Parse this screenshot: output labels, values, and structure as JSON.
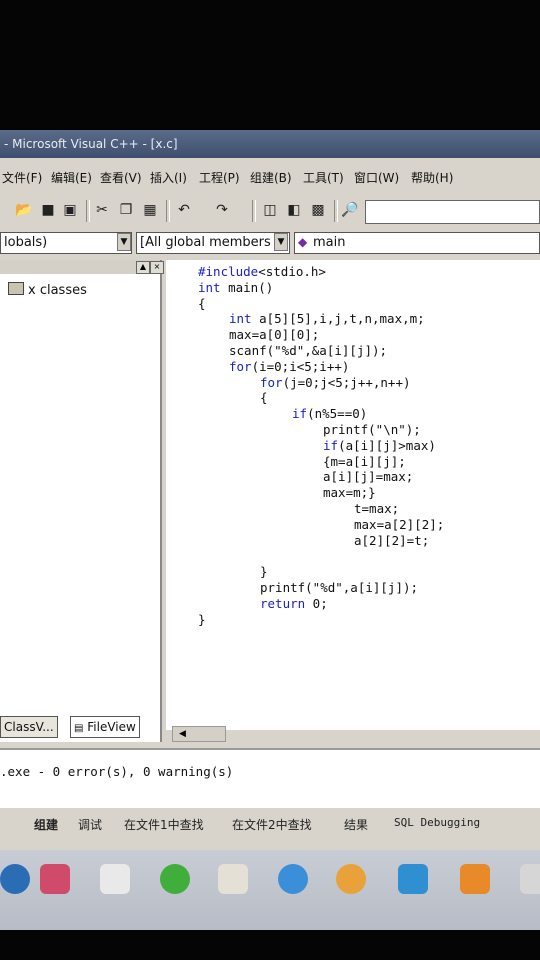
{
  "window": {
    "title": "- Microsoft Visual C++ - [x.c]"
  },
  "menu": [
    "文件(F)",
    "编辑(E)",
    "查看(V)",
    "插入(I)",
    "工程(P)",
    "组建(B)",
    "工具(T)",
    "窗口(W)",
    "帮助(H)"
  ],
  "toolbar": {
    "icons": [
      "open-icon",
      "save-icon",
      "save-all-icon",
      "cut-icon",
      "copy-icon",
      "paste-icon",
      "undo-icon",
      "redo-icon",
      "workspace-icon",
      "output-icon",
      "window-list-icon",
      "find-in-files-icon"
    ]
  },
  "wizard_bar": {
    "class_combo": "lobals)",
    "members_combo": "[All global members",
    "function_combo": "main"
  },
  "workspace": {
    "tree_node": "x classes",
    "tabs": [
      "ClassV...",
      "FileView"
    ]
  },
  "code_lines": [
    {
      "text": "#include<stdio.h>",
      "indent": 0,
      "kw": ""
    },
    {
      "text": "int main()",
      "indent": 0,
      "kw": "int"
    },
    {
      "text": "{",
      "indent": 0,
      "kw": ""
    },
    {
      "text": "int a[5][5],i,j,t,n,max,m;",
      "indent": 1,
      "kw": "int"
    },
    {
      "text": "max=a[0][0];",
      "indent": 1,
      "kw": ""
    },
    {
      "text": "scanf(\"%d\",&a[i][j]);",
      "indent": 1,
      "kw": ""
    },
    {
      "text": "for(i=0;i<5;i++)",
      "indent": 1,
      "kw": "for"
    },
    {
      "text": "for(j=0;j<5;j++,n++)",
      "indent": 2,
      "kw": "for"
    },
    {
      "text": "{",
      "indent": 2,
      "kw": ""
    },
    {
      "text": "if(n%5==0)",
      "indent": 3,
      "kw": "if"
    },
    {
      "text": "printf(\"\\n\");",
      "indent": 4,
      "kw": ""
    },
    {
      "text": "if(a[i][j]>max)",
      "indent": 4,
      "kw": "if"
    },
    {
      "text": "{m=a[i][j];",
      "indent": 4,
      "kw": ""
    },
    {
      "text": "a[i][j]=max;",
      "indent": 4,
      "kw": ""
    },
    {
      "text": "max=m;}",
      "indent": 4,
      "kw": ""
    },
    {
      "text": "t=max;",
      "indent": 5,
      "kw": ""
    },
    {
      "text": "max=a[2][2];",
      "indent": 5,
      "kw": ""
    },
    {
      "text": "a[2][2]=t;",
      "indent": 5,
      "kw": ""
    },
    {
      "text": "",
      "indent": 0,
      "kw": ""
    },
    {
      "text": "}",
      "indent": 2,
      "kw": ""
    },
    {
      "text": "printf(\"%d\",a[i][j]);",
      "indent": 2,
      "kw": ""
    },
    {
      "text": "return 0;",
      "indent": 2,
      "kw": "return"
    },
    {
      "text": "}",
      "indent": 0,
      "kw": ""
    }
  ],
  "output": {
    "build_result": ".exe - 0 error(s), 0 warning(s)",
    "tabs": [
      "组建",
      "调试",
      "在文件1中查找",
      "在文件2中查找",
      "结果",
      "SQL Debugging"
    ]
  },
  "taskbar": {
    "icons": [
      {
        "name": "start-icon",
        "color": "#2a6db5"
      },
      {
        "name": "app-icon",
        "color": "#d04a6a"
      },
      {
        "name": "blank-icon",
        "color": "#e9e9e9"
      },
      {
        "name": "browser-icon",
        "color": "#3fae3a"
      },
      {
        "name": "folder-icon",
        "color": "#e4e0d6"
      },
      {
        "name": "chat-icon",
        "color": "#3b8fd8"
      },
      {
        "name": "chrome-icon",
        "color": "#e9a23a"
      },
      {
        "name": "network-icon",
        "color": "#2f8fd0"
      },
      {
        "name": "ime-icon",
        "color": "#e88a2a"
      },
      {
        "name": "tray-icon",
        "color": "#d6d6d6"
      }
    ]
  }
}
